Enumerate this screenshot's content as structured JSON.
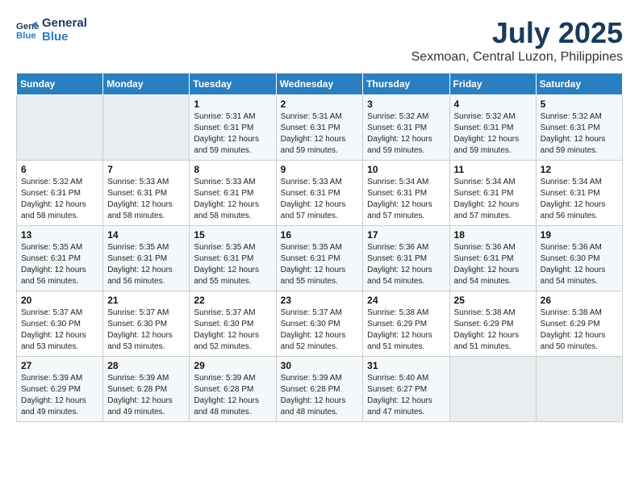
{
  "logo": {
    "line1": "General",
    "line2": "Blue"
  },
  "title": "July 2025",
  "subtitle": "Sexmoan, Central Luzon, Philippines",
  "days_of_week": [
    "Sunday",
    "Monday",
    "Tuesday",
    "Wednesday",
    "Thursday",
    "Friday",
    "Saturday"
  ],
  "weeks": [
    [
      {
        "day": "",
        "info": ""
      },
      {
        "day": "",
        "info": ""
      },
      {
        "day": "1",
        "info": "Sunrise: 5:31 AM\nSunset: 6:31 PM\nDaylight: 12 hours and 59 minutes."
      },
      {
        "day": "2",
        "info": "Sunrise: 5:31 AM\nSunset: 6:31 PM\nDaylight: 12 hours and 59 minutes."
      },
      {
        "day": "3",
        "info": "Sunrise: 5:32 AM\nSunset: 6:31 PM\nDaylight: 12 hours and 59 minutes."
      },
      {
        "day": "4",
        "info": "Sunrise: 5:32 AM\nSunset: 6:31 PM\nDaylight: 12 hours and 59 minutes."
      },
      {
        "day": "5",
        "info": "Sunrise: 5:32 AM\nSunset: 6:31 PM\nDaylight: 12 hours and 59 minutes."
      }
    ],
    [
      {
        "day": "6",
        "info": "Sunrise: 5:32 AM\nSunset: 6:31 PM\nDaylight: 12 hours and 58 minutes."
      },
      {
        "day": "7",
        "info": "Sunrise: 5:33 AM\nSunset: 6:31 PM\nDaylight: 12 hours and 58 minutes."
      },
      {
        "day": "8",
        "info": "Sunrise: 5:33 AM\nSunset: 6:31 PM\nDaylight: 12 hours and 58 minutes."
      },
      {
        "day": "9",
        "info": "Sunrise: 5:33 AM\nSunset: 6:31 PM\nDaylight: 12 hours and 57 minutes."
      },
      {
        "day": "10",
        "info": "Sunrise: 5:34 AM\nSunset: 6:31 PM\nDaylight: 12 hours and 57 minutes."
      },
      {
        "day": "11",
        "info": "Sunrise: 5:34 AM\nSunset: 6:31 PM\nDaylight: 12 hours and 57 minutes."
      },
      {
        "day": "12",
        "info": "Sunrise: 5:34 AM\nSunset: 6:31 PM\nDaylight: 12 hours and 56 minutes."
      }
    ],
    [
      {
        "day": "13",
        "info": "Sunrise: 5:35 AM\nSunset: 6:31 PM\nDaylight: 12 hours and 56 minutes."
      },
      {
        "day": "14",
        "info": "Sunrise: 5:35 AM\nSunset: 6:31 PM\nDaylight: 12 hours and 56 minutes."
      },
      {
        "day": "15",
        "info": "Sunrise: 5:35 AM\nSunset: 6:31 PM\nDaylight: 12 hours and 55 minutes."
      },
      {
        "day": "16",
        "info": "Sunrise: 5:35 AM\nSunset: 6:31 PM\nDaylight: 12 hours and 55 minutes."
      },
      {
        "day": "17",
        "info": "Sunrise: 5:36 AM\nSunset: 6:31 PM\nDaylight: 12 hours and 54 minutes."
      },
      {
        "day": "18",
        "info": "Sunrise: 5:36 AM\nSunset: 6:31 PM\nDaylight: 12 hours and 54 minutes."
      },
      {
        "day": "19",
        "info": "Sunrise: 5:36 AM\nSunset: 6:30 PM\nDaylight: 12 hours and 54 minutes."
      }
    ],
    [
      {
        "day": "20",
        "info": "Sunrise: 5:37 AM\nSunset: 6:30 PM\nDaylight: 12 hours and 53 minutes."
      },
      {
        "day": "21",
        "info": "Sunrise: 5:37 AM\nSunset: 6:30 PM\nDaylight: 12 hours and 53 minutes."
      },
      {
        "day": "22",
        "info": "Sunrise: 5:37 AM\nSunset: 6:30 PM\nDaylight: 12 hours and 52 minutes."
      },
      {
        "day": "23",
        "info": "Sunrise: 5:37 AM\nSunset: 6:30 PM\nDaylight: 12 hours and 52 minutes."
      },
      {
        "day": "24",
        "info": "Sunrise: 5:38 AM\nSunset: 6:29 PM\nDaylight: 12 hours and 51 minutes."
      },
      {
        "day": "25",
        "info": "Sunrise: 5:38 AM\nSunset: 6:29 PM\nDaylight: 12 hours and 51 minutes."
      },
      {
        "day": "26",
        "info": "Sunrise: 5:38 AM\nSunset: 6:29 PM\nDaylight: 12 hours and 50 minutes."
      }
    ],
    [
      {
        "day": "27",
        "info": "Sunrise: 5:39 AM\nSunset: 6:29 PM\nDaylight: 12 hours and 49 minutes."
      },
      {
        "day": "28",
        "info": "Sunrise: 5:39 AM\nSunset: 6:28 PM\nDaylight: 12 hours and 49 minutes."
      },
      {
        "day": "29",
        "info": "Sunrise: 5:39 AM\nSunset: 6:28 PM\nDaylight: 12 hours and 48 minutes."
      },
      {
        "day": "30",
        "info": "Sunrise: 5:39 AM\nSunset: 6:28 PM\nDaylight: 12 hours and 48 minutes."
      },
      {
        "day": "31",
        "info": "Sunrise: 5:40 AM\nSunset: 6:27 PM\nDaylight: 12 hours and 47 minutes."
      },
      {
        "day": "",
        "info": ""
      },
      {
        "day": "",
        "info": ""
      }
    ]
  ]
}
